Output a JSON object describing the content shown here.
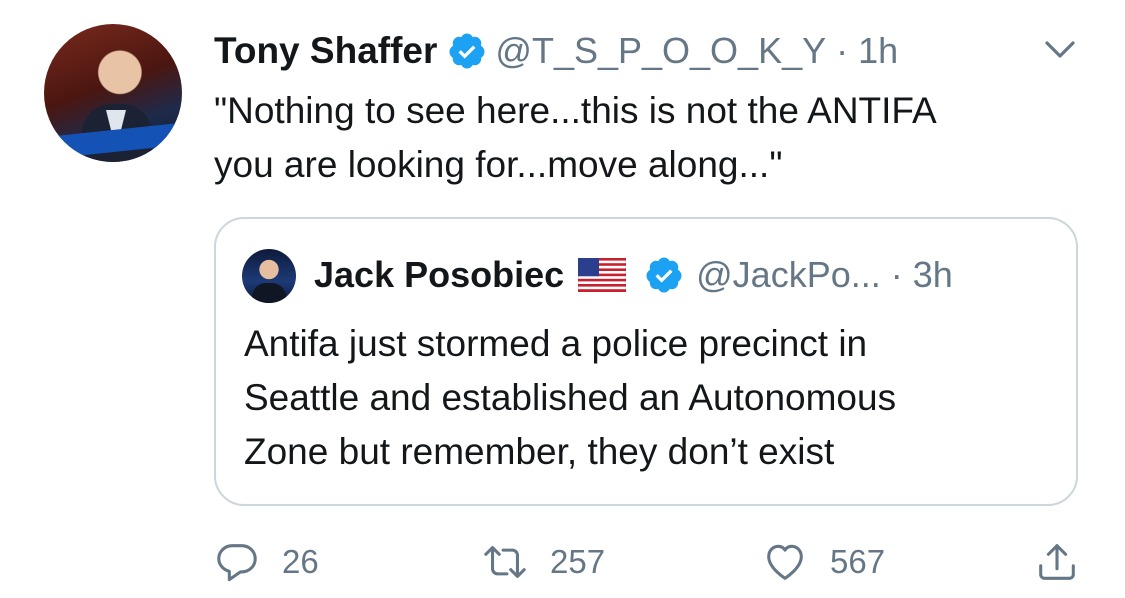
{
  "tweet": {
    "display_name": "Tony Shaffer",
    "handle": "@T_S_P_O_O_K_Y",
    "separator": "·",
    "time": "1h",
    "text_line1": "\"Nothing to see here...this is not the ANTIFA",
    "text_line2": "you are looking for...move along...\""
  },
  "quoted": {
    "display_name": "Jack Posobiec",
    "handle": "@JackPo...",
    "separator": "·",
    "time": "3h",
    "text_line1": "Antifa just stormed a police precinct in",
    "text_line2": "Seattle and established an Autonomous",
    "text_line3": "Zone but remember, they don’t exist"
  },
  "actions": {
    "reply_count": "26",
    "retweet_count": "257",
    "like_count": "567"
  },
  "colors": {
    "verified_blue": "#1da1f2",
    "secondary_text": "#657786",
    "border": "#ccd6dd"
  },
  "icons": {
    "verified": "verified-badge-icon",
    "chevron": "chevron-down-icon",
    "reply": "reply-bubble-icon",
    "retweet": "retweet-icon",
    "like": "heart-icon",
    "share": "share-upload-icon",
    "flag": "us-flag-icon"
  }
}
